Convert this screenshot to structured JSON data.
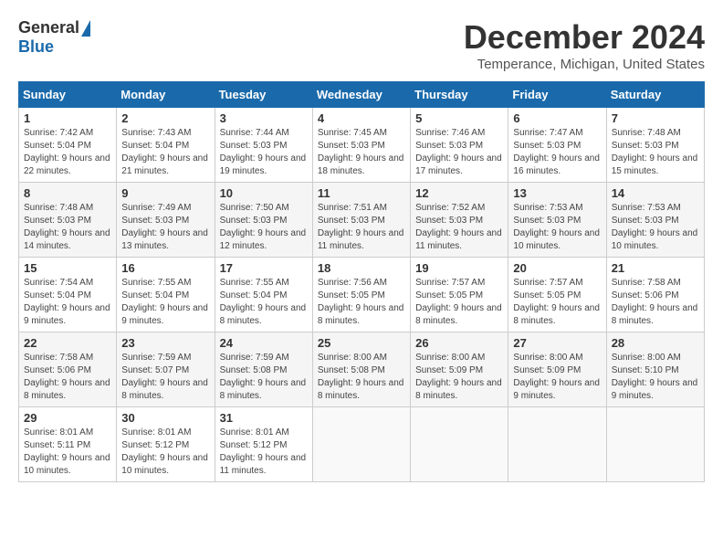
{
  "logo": {
    "general": "General",
    "blue": "Blue"
  },
  "title": "December 2024",
  "location": "Temperance, Michigan, United States",
  "headers": [
    "Sunday",
    "Monday",
    "Tuesday",
    "Wednesday",
    "Thursday",
    "Friday",
    "Saturday"
  ],
  "weeks": [
    [
      {
        "day": "1",
        "sunrise": "7:42 AM",
        "sunset": "5:04 PM",
        "daylight": "9 hours and 22 minutes."
      },
      {
        "day": "2",
        "sunrise": "7:43 AM",
        "sunset": "5:04 PM",
        "daylight": "9 hours and 21 minutes."
      },
      {
        "day": "3",
        "sunrise": "7:44 AM",
        "sunset": "5:03 PM",
        "daylight": "9 hours and 19 minutes."
      },
      {
        "day": "4",
        "sunrise": "7:45 AM",
        "sunset": "5:03 PM",
        "daylight": "9 hours and 18 minutes."
      },
      {
        "day": "5",
        "sunrise": "7:46 AM",
        "sunset": "5:03 PM",
        "daylight": "9 hours and 17 minutes."
      },
      {
        "day": "6",
        "sunrise": "7:47 AM",
        "sunset": "5:03 PM",
        "daylight": "9 hours and 16 minutes."
      },
      {
        "day": "7",
        "sunrise": "7:48 AM",
        "sunset": "5:03 PM",
        "daylight": "9 hours and 15 minutes."
      }
    ],
    [
      {
        "day": "8",
        "sunrise": "7:48 AM",
        "sunset": "5:03 PM",
        "daylight": "9 hours and 14 minutes."
      },
      {
        "day": "9",
        "sunrise": "7:49 AM",
        "sunset": "5:03 PM",
        "daylight": "9 hours and 13 minutes."
      },
      {
        "day": "10",
        "sunrise": "7:50 AM",
        "sunset": "5:03 PM",
        "daylight": "9 hours and 12 minutes."
      },
      {
        "day": "11",
        "sunrise": "7:51 AM",
        "sunset": "5:03 PM",
        "daylight": "9 hours and 11 minutes."
      },
      {
        "day": "12",
        "sunrise": "7:52 AM",
        "sunset": "5:03 PM",
        "daylight": "9 hours and 11 minutes."
      },
      {
        "day": "13",
        "sunrise": "7:53 AM",
        "sunset": "5:03 PM",
        "daylight": "9 hours and 10 minutes."
      },
      {
        "day": "14",
        "sunrise": "7:53 AM",
        "sunset": "5:03 PM",
        "daylight": "9 hours and 10 minutes."
      }
    ],
    [
      {
        "day": "15",
        "sunrise": "7:54 AM",
        "sunset": "5:04 PM",
        "daylight": "9 hours and 9 minutes."
      },
      {
        "day": "16",
        "sunrise": "7:55 AM",
        "sunset": "5:04 PM",
        "daylight": "9 hours and 9 minutes."
      },
      {
        "day": "17",
        "sunrise": "7:55 AM",
        "sunset": "5:04 PM",
        "daylight": "9 hours and 8 minutes."
      },
      {
        "day": "18",
        "sunrise": "7:56 AM",
        "sunset": "5:05 PM",
        "daylight": "9 hours and 8 minutes."
      },
      {
        "day": "19",
        "sunrise": "7:57 AM",
        "sunset": "5:05 PM",
        "daylight": "9 hours and 8 minutes."
      },
      {
        "day": "20",
        "sunrise": "7:57 AM",
        "sunset": "5:05 PM",
        "daylight": "9 hours and 8 minutes."
      },
      {
        "day": "21",
        "sunrise": "7:58 AM",
        "sunset": "5:06 PM",
        "daylight": "9 hours and 8 minutes."
      }
    ],
    [
      {
        "day": "22",
        "sunrise": "7:58 AM",
        "sunset": "5:06 PM",
        "daylight": "9 hours and 8 minutes."
      },
      {
        "day": "23",
        "sunrise": "7:59 AM",
        "sunset": "5:07 PM",
        "daylight": "9 hours and 8 minutes."
      },
      {
        "day": "24",
        "sunrise": "7:59 AM",
        "sunset": "5:08 PM",
        "daylight": "9 hours and 8 minutes."
      },
      {
        "day": "25",
        "sunrise": "8:00 AM",
        "sunset": "5:08 PM",
        "daylight": "9 hours and 8 minutes."
      },
      {
        "day": "26",
        "sunrise": "8:00 AM",
        "sunset": "5:09 PM",
        "daylight": "9 hours and 8 minutes."
      },
      {
        "day": "27",
        "sunrise": "8:00 AM",
        "sunset": "5:09 PM",
        "daylight": "9 hours and 9 minutes."
      },
      {
        "day": "28",
        "sunrise": "8:00 AM",
        "sunset": "5:10 PM",
        "daylight": "9 hours and 9 minutes."
      }
    ],
    [
      {
        "day": "29",
        "sunrise": "8:01 AM",
        "sunset": "5:11 PM",
        "daylight": "9 hours and 10 minutes."
      },
      {
        "day": "30",
        "sunrise": "8:01 AM",
        "sunset": "5:12 PM",
        "daylight": "9 hours and 10 minutes."
      },
      {
        "day": "31",
        "sunrise": "8:01 AM",
        "sunset": "5:12 PM",
        "daylight": "9 hours and 11 minutes."
      },
      null,
      null,
      null,
      null
    ]
  ]
}
